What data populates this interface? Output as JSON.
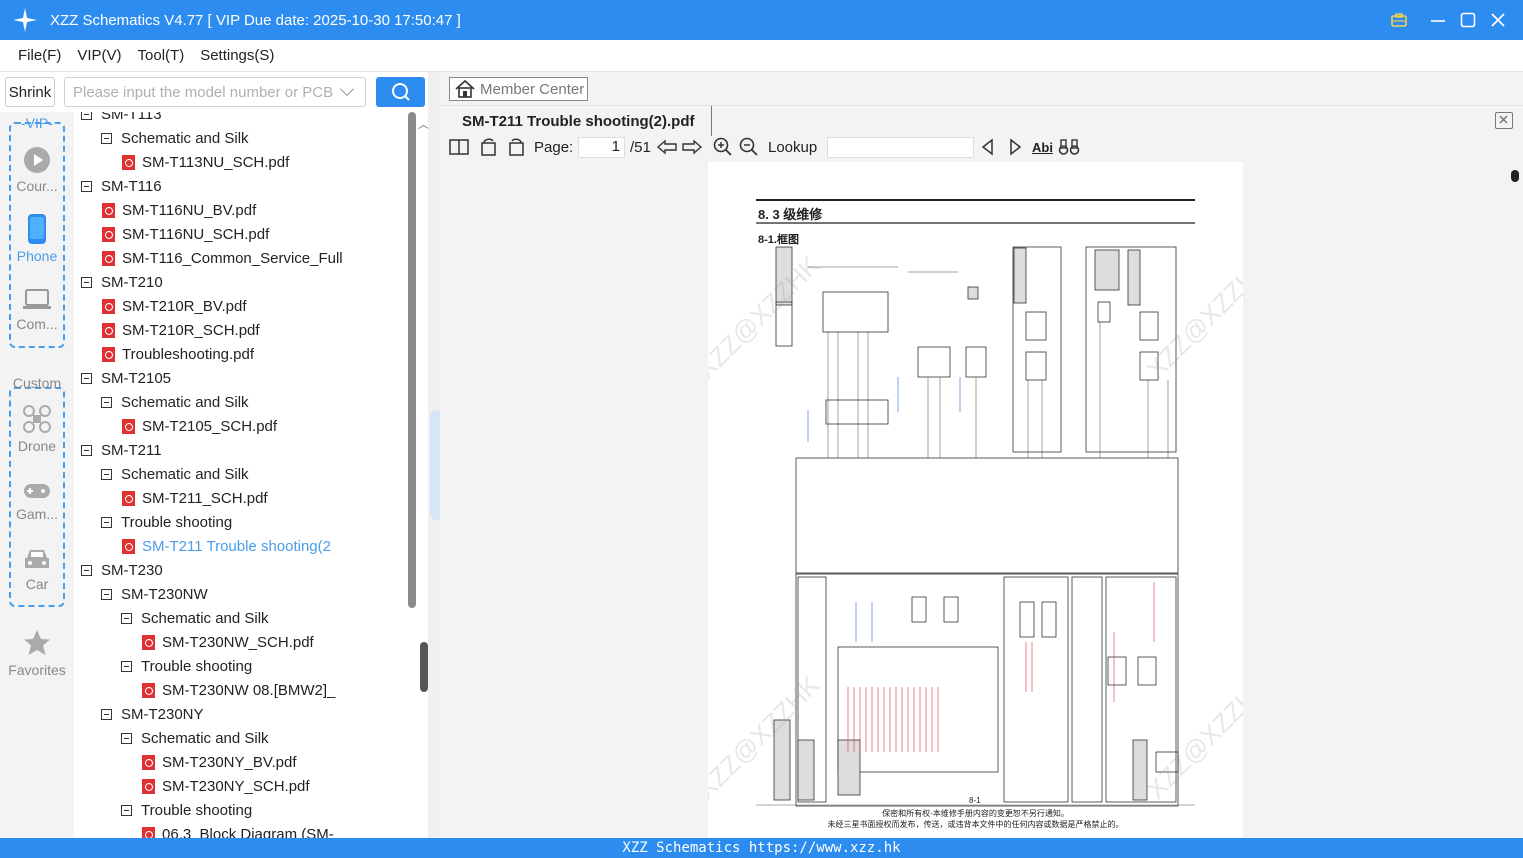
{
  "app": {
    "title": "XZZ Schematics V4.77 [ VIP Due date: 2025-10-30 17:50:47 ]",
    "accent": "#2d8cf0"
  },
  "menu": [
    "File(F)",
    "VIP(V)",
    "Tool(T)",
    "Settings(S)"
  ],
  "search": {
    "shrink_label": "Shrink",
    "placeholder": "Please input the model number or PCB"
  },
  "sidebar": {
    "vip_label": "-VIP-",
    "vip_items": [
      {
        "label": "Cour...",
        "icon": "play-icon"
      },
      {
        "label": "Phone",
        "icon": "phone-icon"
      },
      {
        "label": "Com...",
        "icon": "laptop-icon"
      }
    ],
    "custom_label": "Custom",
    "custom_items": [
      {
        "label": "Drone",
        "icon": "drone-icon"
      },
      {
        "label": "Gam...",
        "icon": "gamepad-icon"
      },
      {
        "label": "Car",
        "icon": "car-icon"
      }
    ],
    "favorites_label": "Favorites"
  },
  "tree": [
    {
      "label": "SM-T113",
      "type": "folder",
      "level": 0
    },
    {
      "label": "Schematic and Silk",
      "type": "folder",
      "level": 1
    },
    {
      "label": "SM-T113NU_SCH.pdf",
      "type": "pdf",
      "level": 2
    },
    {
      "label": "SM-T116",
      "type": "folder",
      "level": 0
    },
    {
      "label": "SM-T116NU_BV.pdf",
      "type": "pdf",
      "level": 1
    },
    {
      "label": "SM-T116NU_SCH.pdf",
      "type": "pdf",
      "level": 1
    },
    {
      "label": "SM-T116_Common_Service_Full",
      "type": "pdf",
      "level": 1
    },
    {
      "label": "SM-T210",
      "type": "folder",
      "level": 0
    },
    {
      "label": "SM-T210R_BV.pdf",
      "type": "pdf",
      "level": 1
    },
    {
      "label": "SM-T210R_SCH.pdf",
      "type": "pdf",
      "level": 1
    },
    {
      "label": "Troubleshooting.pdf",
      "type": "pdf",
      "level": 1
    },
    {
      "label": "SM-T2105",
      "type": "folder",
      "level": 0
    },
    {
      "label": "Schematic and Silk",
      "type": "folder",
      "level": 1
    },
    {
      "label": "SM-T2105_SCH.pdf",
      "type": "pdf",
      "level": 2
    },
    {
      "label": "SM-T211",
      "type": "folder",
      "level": 0
    },
    {
      "label": "Schematic and Silk",
      "type": "folder",
      "level": 1
    },
    {
      "label": "SM-T211_SCH.pdf",
      "type": "pdf",
      "level": 2
    },
    {
      "label": "Trouble shooting",
      "type": "folder",
      "level": 1
    },
    {
      "label": "SM-T211 Trouble shooting(2",
      "type": "pdf",
      "level": 2,
      "selected": true
    },
    {
      "label": "SM-T230",
      "type": "folder",
      "level": 0
    },
    {
      "label": "SM-T230NW",
      "type": "folder",
      "level": 1
    },
    {
      "label": "Schematic and Silk",
      "type": "folder",
      "level": 2
    },
    {
      "label": "SM-T230NW_SCH.pdf",
      "type": "pdf",
      "level": 3
    },
    {
      "label": "Trouble shooting",
      "type": "folder",
      "level": 2
    },
    {
      "label": "SM-T230NW 08.[BMW2]_",
      "type": "pdf",
      "level": 3
    },
    {
      "label": "SM-T230NY",
      "type": "folder",
      "level": 1
    },
    {
      "label": "Schematic and Silk",
      "type": "folder",
      "level": 2
    },
    {
      "label": "SM-T230NY_BV.pdf",
      "type": "pdf",
      "level": 3
    },
    {
      "label": "SM-T230NY_SCH.pdf",
      "type": "pdf",
      "level": 3
    },
    {
      "label": "Trouble shooting",
      "type": "folder",
      "level": 2
    },
    {
      "label": "06.3_Block Diagram (SM-",
      "type": "pdf",
      "level": 3
    }
  ],
  "viewer": {
    "member_center": "Member Center",
    "doc_tab": "SM-T211 Trouble shooting(2).pdf",
    "page_label": "Page:",
    "page_current": "1",
    "page_total": "/51",
    "lookup_label": "Lookup",
    "abi_label": "Abi"
  },
  "document": {
    "heading": "8. 3 级维修",
    "subheading": "8-1.框图",
    "page_number": "8-1",
    "footer_line1": "保密和所有权-本维修手册内容的变更恕不另行通知。",
    "footer_line2": "未经三星书面授权而发布，传送，或违背本文件中的任何内容或数据是严格禁止的。",
    "watermark": "XZZ@XZZHK"
  },
  "statusbar": {
    "text": "XZZ Schematics https://www.xzz.hk"
  }
}
